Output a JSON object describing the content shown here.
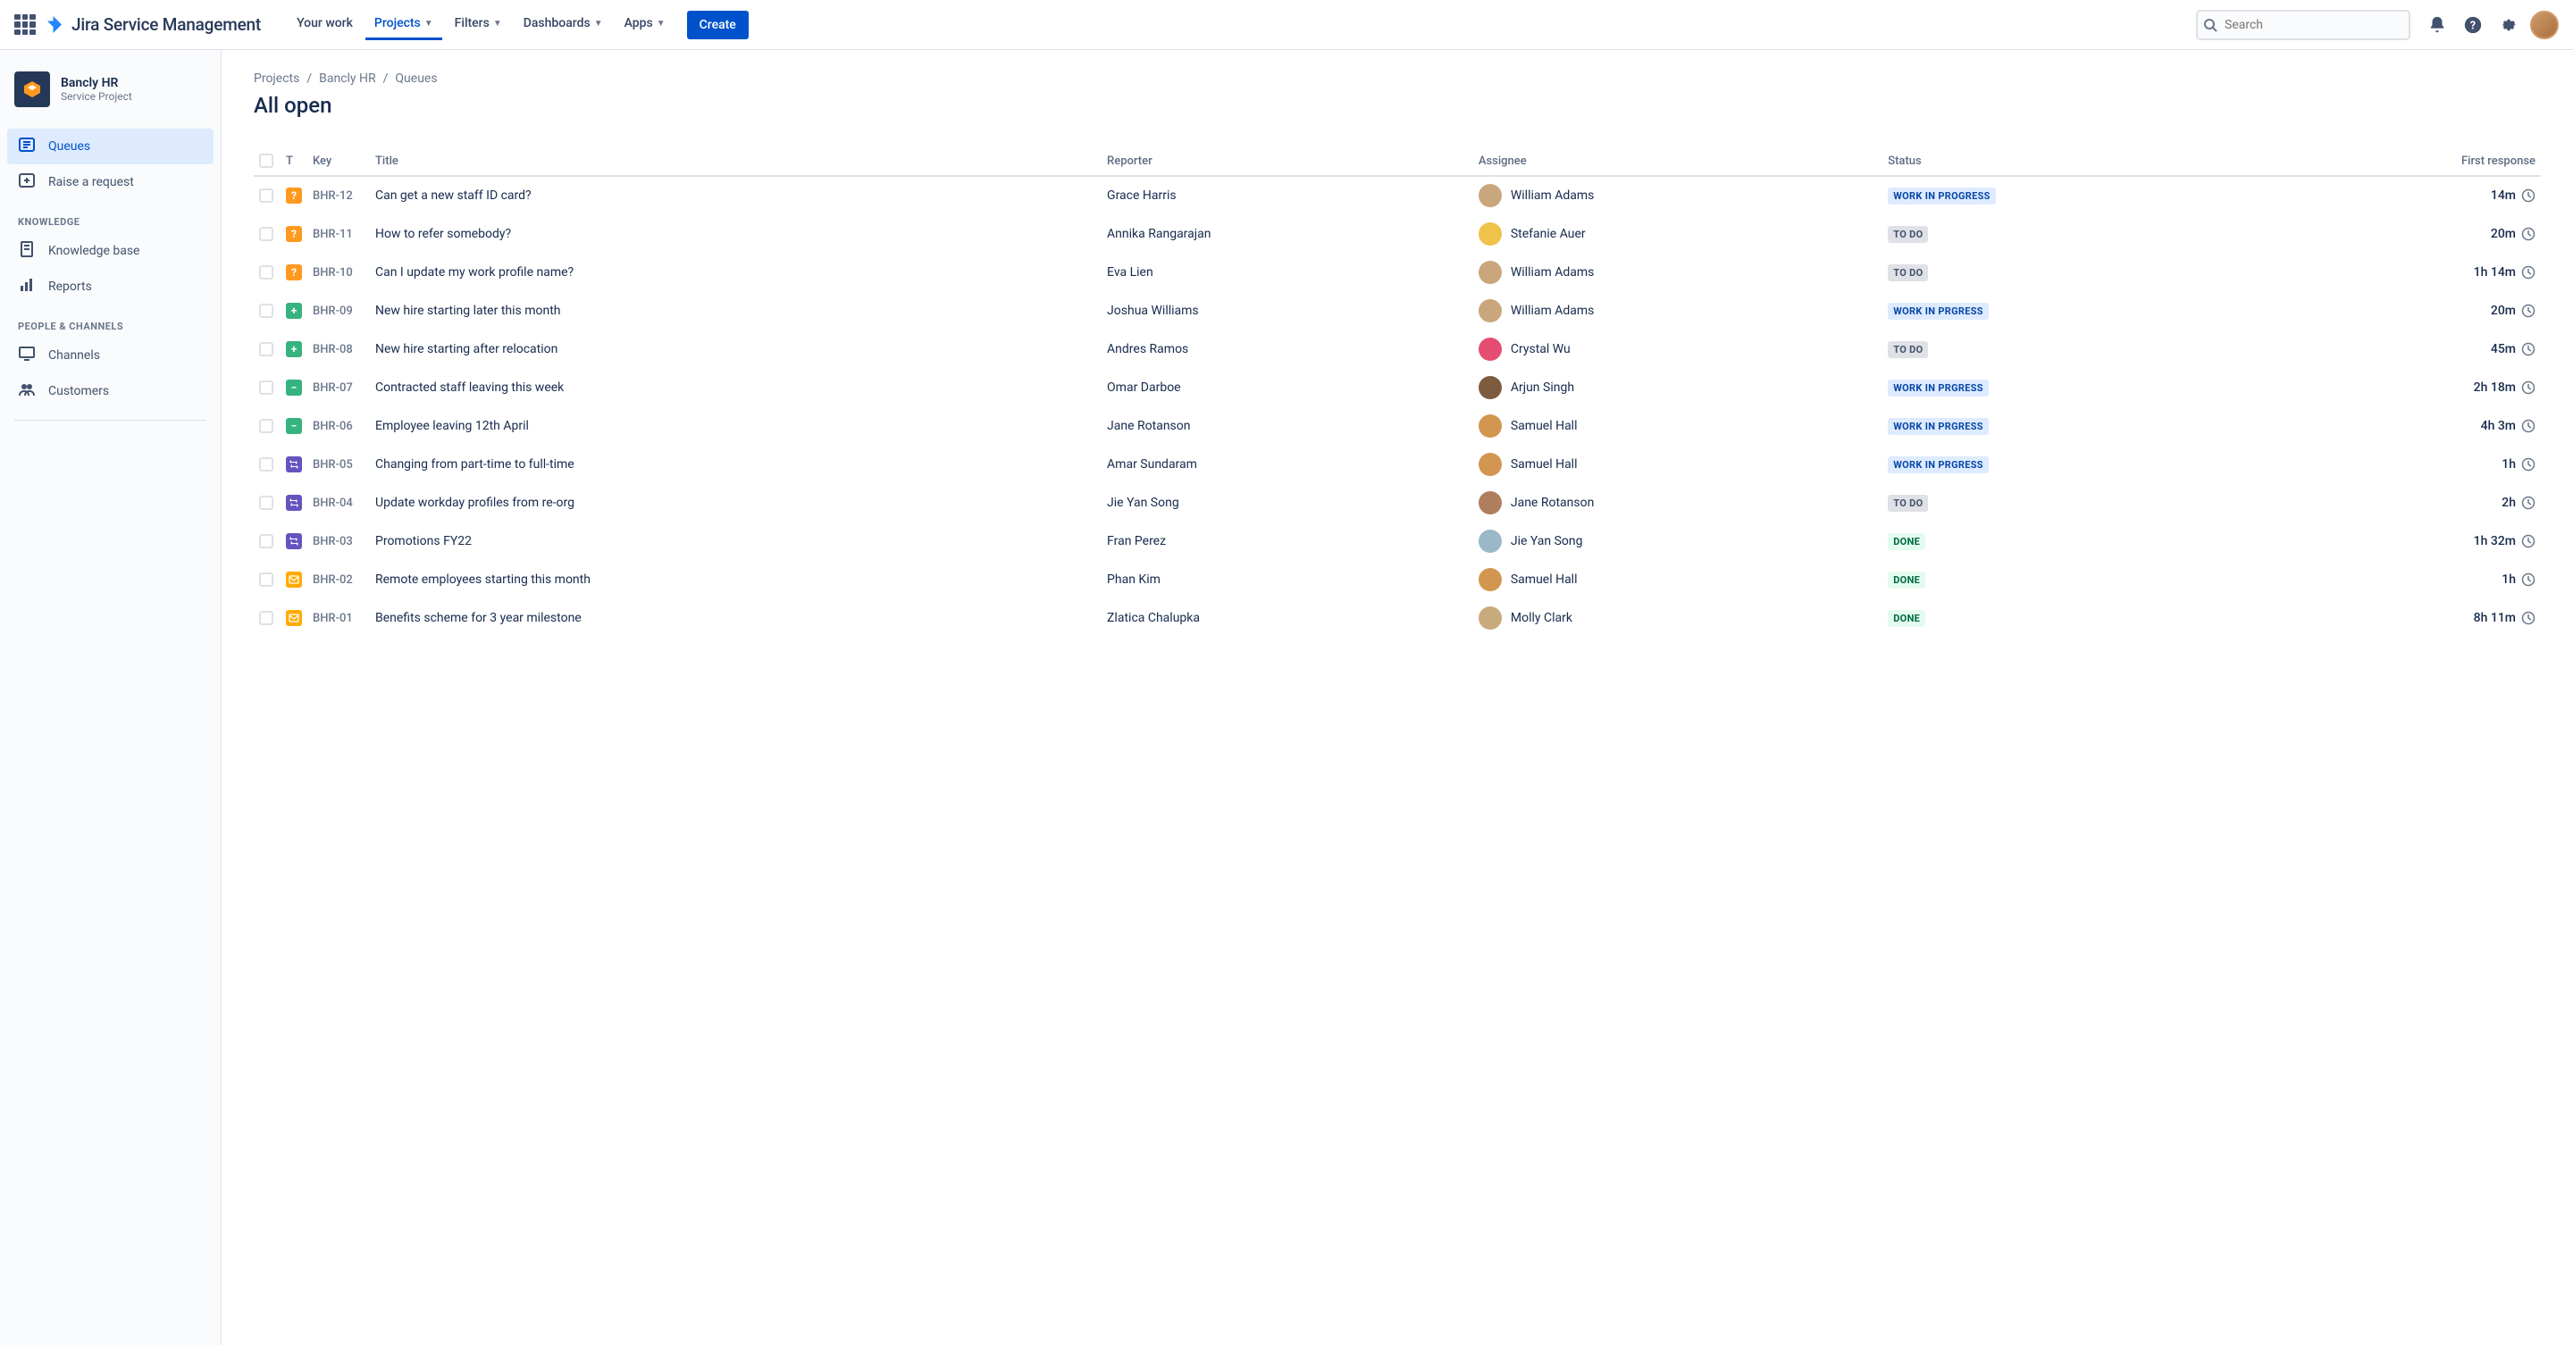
{
  "header": {
    "product_name": "Jira Service Management",
    "nav": [
      "Your work",
      "Projects",
      "Filters",
      "Dashboards",
      "Apps"
    ],
    "nav_dropdown": [
      false,
      true,
      true,
      true,
      true
    ],
    "nav_active_index": 1,
    "create_label": "Create",
    "search_placeholder": "Search"
  },
  "sidebar": {
    "project_name": "Bancly HR",
    "project_type": "Service Project",
    "items_top": [
      {
        "label": "Queues",
        "icon": "queues",
        "active": true
      },
      {
        "label": "Raise a request",
        "icon": "add-request",
        "active": false
      }
    ],
    "group_knowledge": "KNOWLEDGE",
    "items_knowledge": [
      {
        "label": "Knowledge base",
        "icon": "page"
      },
      {
        "label": "Reports",
        "icon": "reports"
      }
    ],
    "group_people": "PEOPLE & CHANNELS",
    "items_people": [
      {
        "label": "Channels",
        "icon": "screen"
      },
      {
        "label": "Customers",
        "icon": "group"
      }
    ]
  },
  "breadcrumb": [
    "Projects",
    "Bancly HR",
    "Queues"
  ],
  "page_title": "All open",
  "table": {
    "columns": [
      "",
      "T",
      "Key",
      "Title",
      "Reporter",
      "Assignee",
      "Status",
      "First response"
    ],
    "rows": [
      {
        "type": "question",
        "key": "BHR-12",
        "title": "Can get a new staff ID card?",
        "reporter": "Grace Harris",
        "assignee": "William Adams",
        "assignee_color": "#c9a67b",
        "status": "WORK IN PROGRESS",
        "status_kind": "wip",
        "response": "14m"
      },
      {
        "type": "question",
        "key": "BHR-11",
        "title": "How to refer somebody?",
        "reporter": "Annika Rangarajan",
        "assignee": "Stefanie Auer",
        "assignee_color": "#efc24a",
        "status": "TO DO",
        "status_kind": "todo",
        "response": "20m"
      },
      {
        "type": "question",
        "key": "BHR-10",
        "title": "Can I update my work profile name?",
        "reporter": "Eva Lien",
        "assignee": "William Adams",
        "assignee_color": "#c9a67b",
        "status": "TO DO",
        "status_kind": "todo",
        "response": "1h 14m"
      },
      {
        "type": "plus",
        "key": "BHR-09",
        "title": "New hire starting later this month",
        "reporter": "Joshua Williams",
        "assignee": "William Adams",
        "assignee_color": "#c9a67b",
        "status": "WORK IN PRGRESS",
        "status_kind": "wip",
        "response": "20m"
      },
      {
        "type": "plus",
        "key": "BHR-08",
        "title": "New hire starting after relocation",
        "reporter": "Andres Ramos",
        "assignee": "Crystal Wu",
        "assignee_color": "#e54d72",
        "status": "TO DO",
        "status_kind": "todo",
        "response": "45m"
      },
      {
        "type": "minus",
        "key": "BHR-07",
        "title": "Contracted staff leaving this week",
        "reporter": "Omar Darboe",
        "assignee": "Arjun Singh",
        "assignee_color": "#7c5b3f",
        "status": "WORK IN PRGRESS",
        "status_kind": "wip",
        "response": "2h 18m"
      },
      {
        "type": "minus",
        "key": "BHR-06",
        "title": "Employee leaving 12th April",
        "reporter": "Jane Rotanson",
        "assignee": "Samuel Hall",
        "assignee_color": "#d39650",
        "status": "WORK IN PRGRESS",
        "status_kind": "wip",
        "response": "4h 3m"
      },
      {
        "type": "change",
        "key": "BHR-05",
        "title": "Changing from part-time to full-time",
        "reporter": "Amar Sundaram",
        "assignee": "Samuel Hall",
        "assignee_color": "#d39650",
        "status": "WORK IN PRGRESS",
        "status_kind": "wip",
        "response": "1h"
      },
      {
        "type": "change",
        "key": "BHR-04",
        "title": "Update workday profiles from re-org",
        "reporter": "Jie Yan Song",
        "assignee": "Jane Rotanson",
        "assignee_color": "#b07d5e",
        "status": "TO DO",
        "status_kind": "todo",
        "response": "2h"
      },
      {
        "type": "change",
        "key": "BHR-03",
        "title": "Promotions FY22",
        "reporter": "Fran Perez",
        "assignee": "Jie Yan Song",
        "assignee_color": "#9bb8c8",
        "status": "DONE",
        "status_kind": "done",
        "response": "1h 32m"
      },
      {
        "type": "mail",
        "key": "BHR-02",
        "title": "Remote employees starting this month",
        "reporter": "Phan Kim",
        "assignee": "Samuel Hall",
        "assignee_color": "#d39650",
        "status": "DONE",
        "status_kind": "done",
        "response": "1h"
      },
      {
        "type": "mail",
        "key": "BHR-01",
        "title": "Benefits scheme for 3 year milestone",
        "reporter": "Zlatica Chalupka",
        "assignee": "Molly Clark",
        "assignee_color": "#c9aa7d",
        "status": "DONE",
        "status_kind": "done",
        "response": "8h 11m"
      }
    ]
  }
}
